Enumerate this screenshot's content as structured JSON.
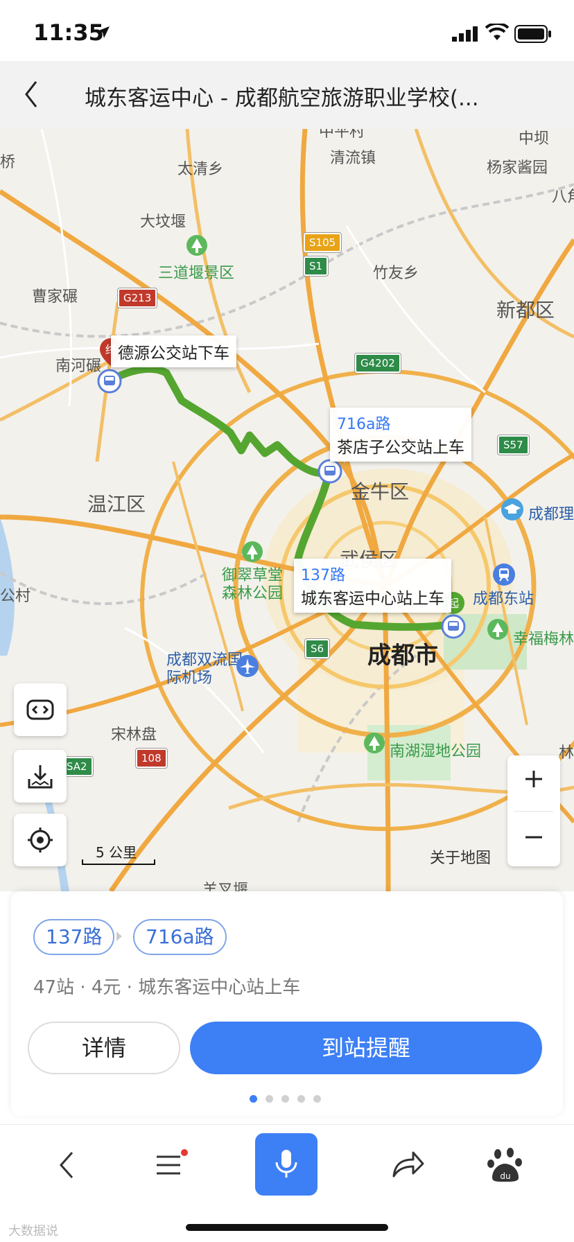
{
  "status_bar": {
    "time": "11:35"
  },
  "header": {
    "title": "城东客运中心 - 成都航空旅游职业学校(..."
  },
  "map": {
    "places": [
      {
        "id": "taiqing",
        "text": "太清乡"
      },
      {
        "id": "qingliu",
        "text": "清流镇"
      },
      {
        "id": "zhongba",
        "text": "中坝"
      },
      {
        "id": "yangjia",
        "text": "杨家酱园"
      },
      {
        "id": "qiao",
        "text": "桥"
      },
      {
        "id": "ba",
        "text": "八角"
      },
      {
        "id": "dawenyan",
        "text": "大坟堰"
      },
      {
        "id": "sandaoyan",
        "text": "三道堰景区"
      },
      {
        "id": "zhuyou",
        "text": "竹友乡"
      },
      {
        "id": "caojia",
        "text": "曹家碾"
      },
      {
        "id": "xindu",
        "text": "新都区"
      },
      {
        "id": "nanhe",
        "text": "南河碾"
      },
      {
        "id": "wenjiang",
        "text": "温江区"
      },
      {
        "id": "jinniu",
        "text": "金牛区"
      },
      {
        "id": "chengduli",
        "text": "成都理"
      },
      {
        "id": "wuhou",
        "text": "武侯区"
      },
      {
        "id": "yucui",
        "text": "御翠草堂森林公园"
      },
      {
        "id": "chengdudong",
        "text": "成都东站"
      },
      {
        "id": "gongcun",
        "text": "公村"
      },
      {
        "id": "xingfu",
        "text": "幸福梅林"
      },
      {
        "id": "chengdushi",
        "text": "成都市"
      },
      {
        "id": "airport",
        "text": "成都双流国际机场"
      },
      {
        "id": "songlinpan",
        "text": "宋林盘"
      },
      {
        "id": "nanhushidi",
        "text": "南湖湿地公园"
      },
      {
        "id": "zhongping",
        "text": "中平村"
      },
      {
        "id": "shengchayan",
        "text": "羊叉堰"
      },
      {
        "id": "lin",
        "text": "林"
      }
    ],
    "shields": [
      {
        "id": "s105",
        "text": "S105",
        "color": "#e8a317"
      },
      {
        "id": "s1",
        "text": "S1",
        "color": "#2e8b48"
      },
      {
        "id": "g213",
        "text": "G213",
        "color": "#c0392b"
      },
      {
        "id": "g4202",
        "text": "G4202",
        "color": "#2e8b48"
      },
      {
        "id": "s57",
        "text": "S57",
        "color": "#2e8b48"
      },
      {
        "id": "s6",
        "text": "S6",
        "color": "#2e8b48"
      },
      {
        "id": "sa2",
        "text": "SA2",
        "color": "#2e8b48"
      },
      {
        "id": "g108",
        "text": "108",
        "color": "#c0392b"
      }
    ],
    "callouts": {
      "dest": {
        "text": "德源公交站下车"
      },
      "transfer": {
        "route": "716a路",
        "text": "茶店子公交站上车"
      },
      "origin": {
        "route": "137路",
        "text": "城东客运中心站上车"
      }
    },
    "scale_label": "5 公里",
    "brand": "关于地图",
    "route_color": "#55a630"
  },
  "card": {
    "routes": [
      "137路",
      "716a路"
    ],
    "summary": "47站 · 4元 · 城东客运中心站上车",
    "detail_label": "详情",
    "remind_label": "到站提醒",
    "page_count": 5,
    "active_page": 1
  },
  "watermark": "大数据说"
}
